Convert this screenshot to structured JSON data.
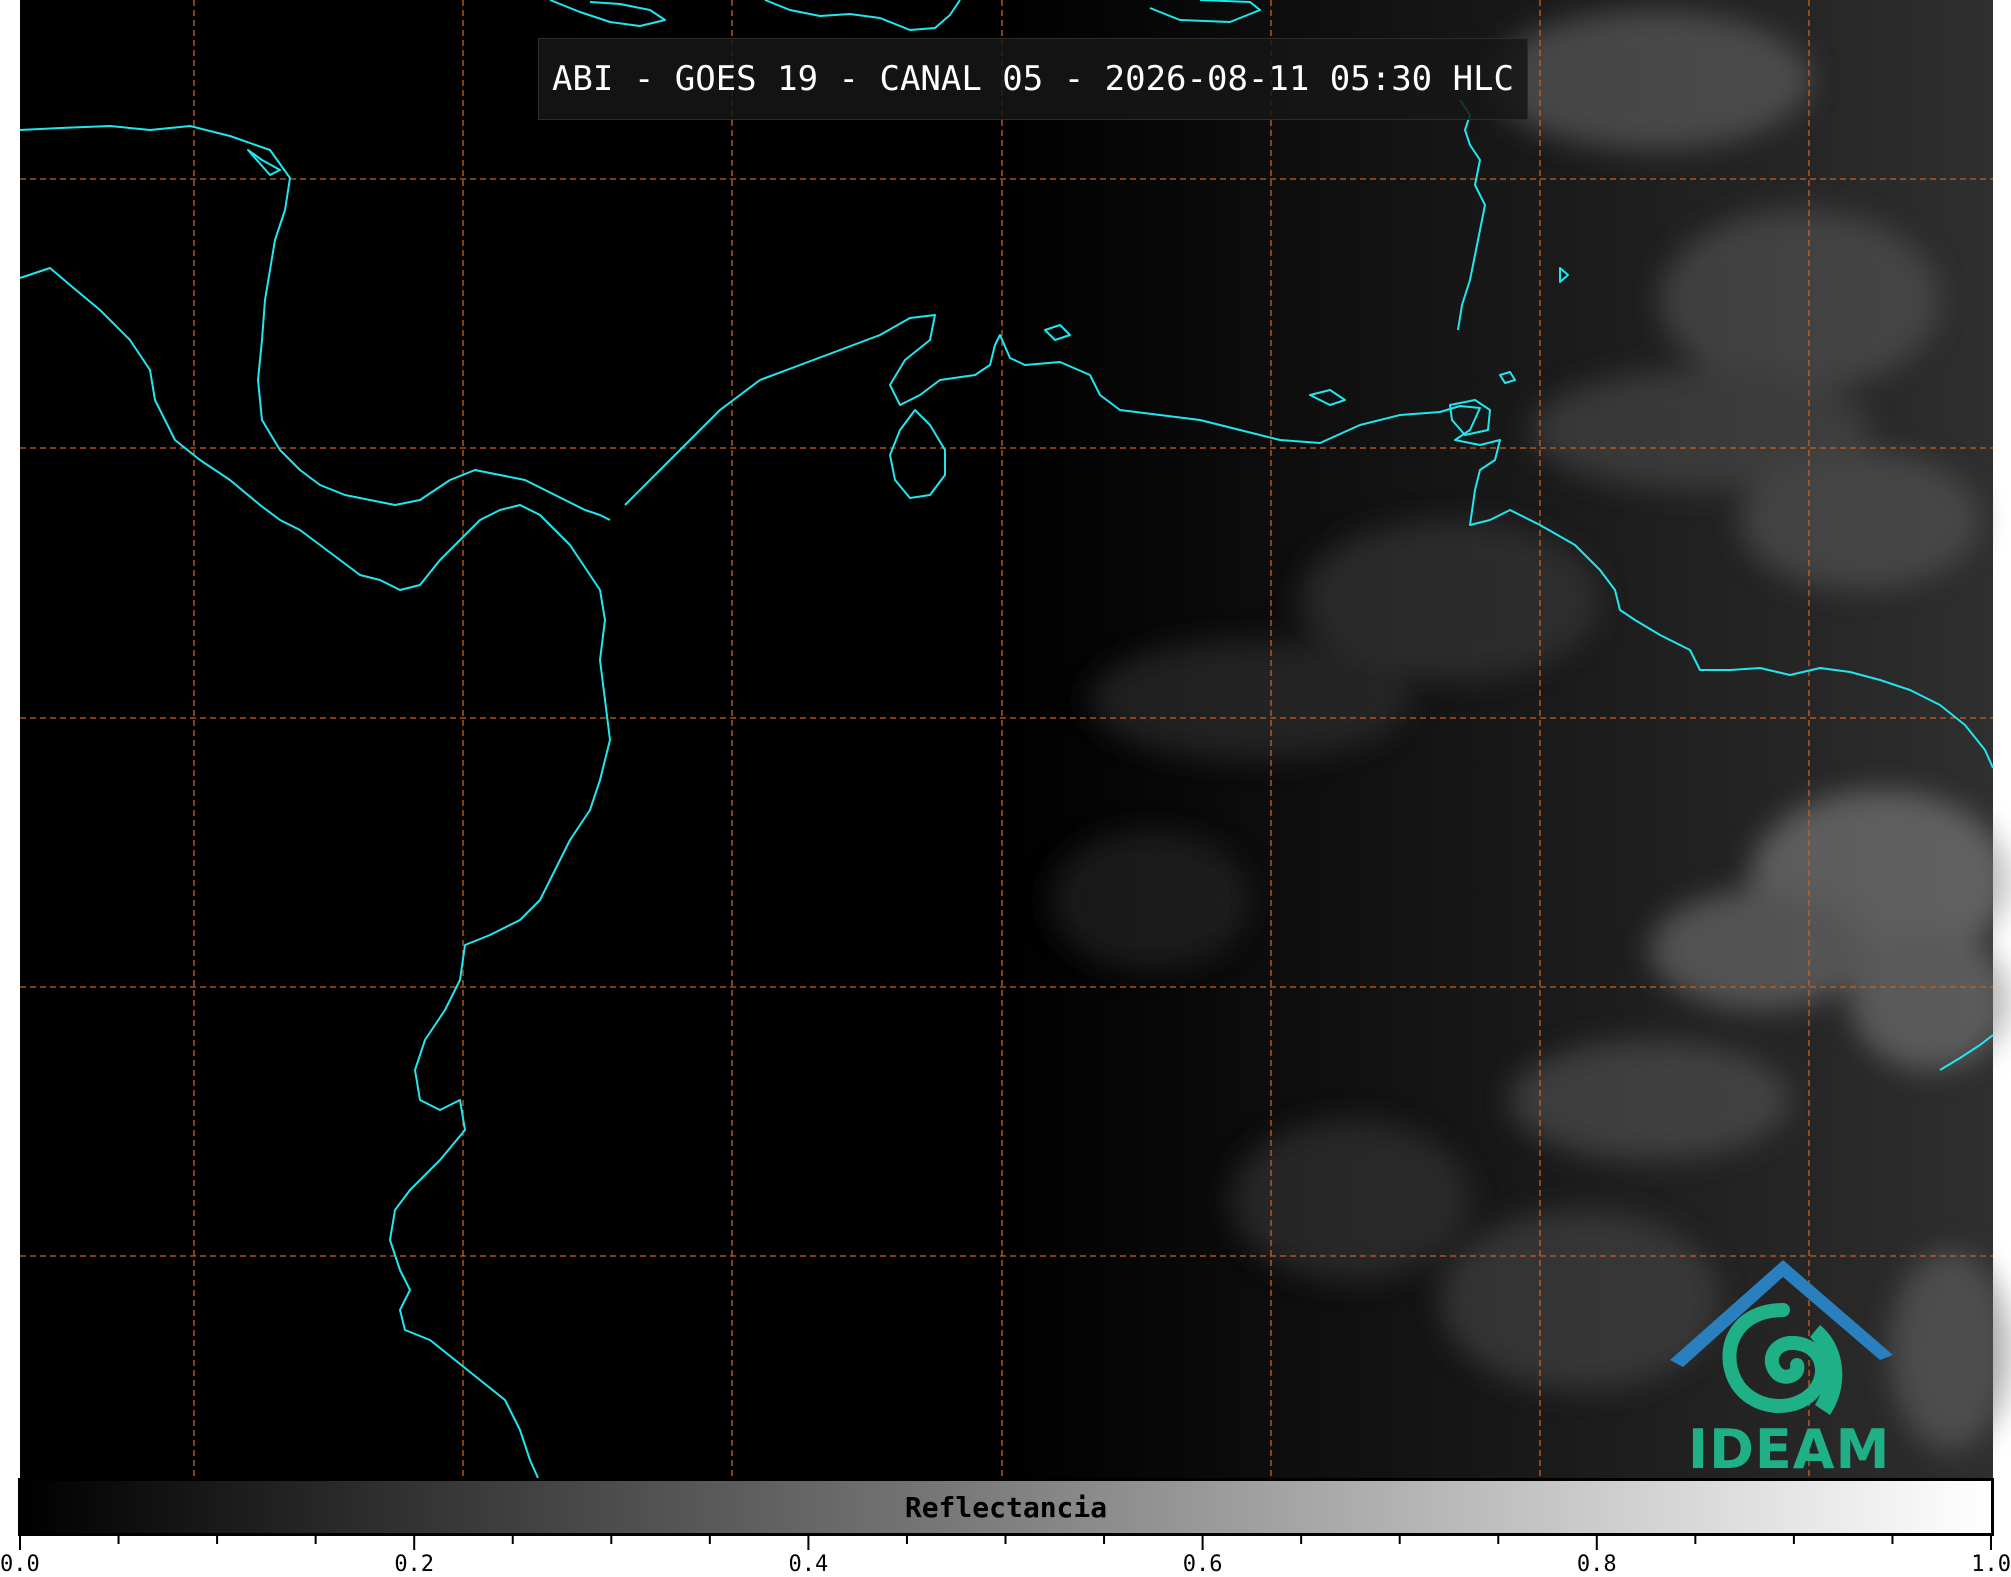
{
  "title": "ABI - GOES 19 - CANAL 05 - 2026-08-11 05:30 HLC",
  "colorbar": {
    "label": "Reflectancia",
    "min": 0.0,
    "max": 1.0,
    "ticks": [
      "0.0",
      "0.2",
      "0.4",
      "0.6",
      "0.8",
      "1.0"
    ],
    "colormap": "grayscale black-to-white"
  },
  "logo": {
    "text": "IDEAM"
  },
  "map": {
    "background_color": "#000000",
    "coastline_color": "#22e6ee",
    "gridline_color": "#c8621e",
    "gridline_style": "dashed",
    "illumination": "night on left half, daylight clouds on right half"
  }
}
